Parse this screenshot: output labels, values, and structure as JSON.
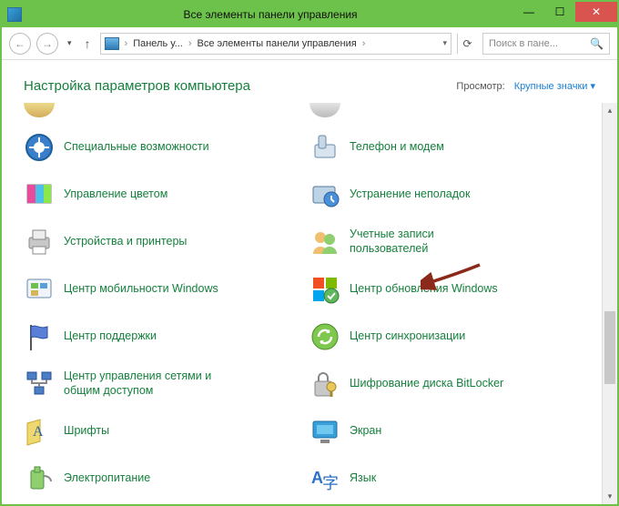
{
  "titlebar": {
    "title": "Все элементы панели управления"
  },
  "nav": {
    "breadcrumb1": "Панель у...",
    "breadcrumb2": "Все элементы панели управления",
    "search_placeholder": "Поиск в пане..."
  },
  "header": {
    "heading": "Настройка параметров компьютера",
    "view_label": "Просмотр:",
    "view_value": "Крупные значки"
  },
  "items": {
    "left": [
      "Специальные возможности",
      "Управление цветом",
      "Устройства и принтеры",
      "Центр мобильности Windows",
      "Центр поддержки",
      "Центр управления сетями и общим доступом",
      "Шрифты",
      "Электропитание"
    ],
    "right": [
      "Телефон и модем",
      "Устранение неполадок",
      "Учетные записи пользователей",
      "Центр обновления Windows",
      "Центр синхронизации",
      "Шифрование диска BitLocker",
      "Экран",
      "Язык"
    ]
  }
}
